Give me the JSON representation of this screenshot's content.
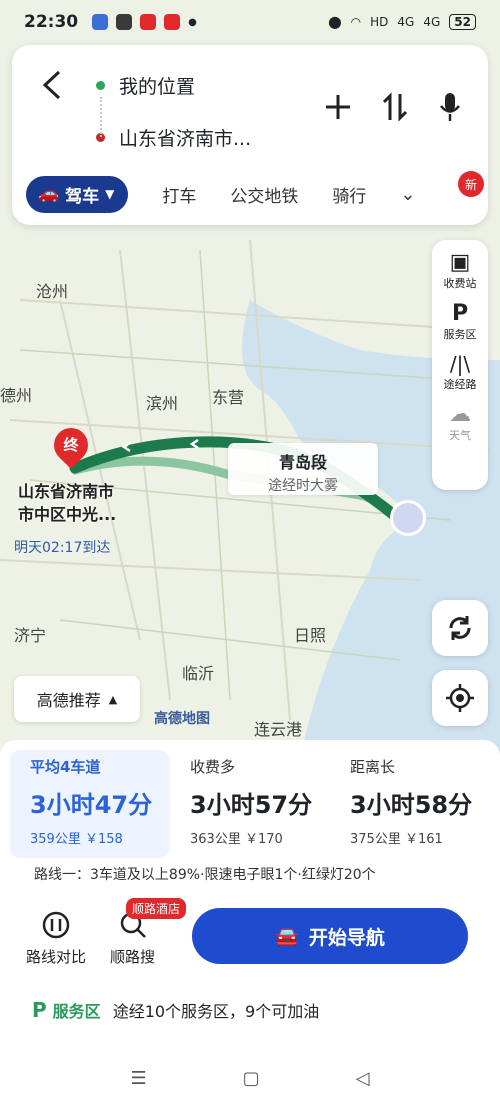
{
  "status": {
    "time": "22:30",
    "battery": "52",
    "signal1": "4G",
    "signal2": "4G",
    "hd": "HD"
  },
  "search": {
    "origin": "我的位置",
    "destination": "山东省济南市..."
  },
  "tabs": [
    {
      "label": "驾车",
      "active": true
    },
    {
      "label": "打车"
    },
    {
      "label": "公交地铁"
    },
    {
      "label": "骑行"
    }
  ],
  "new_badge": "新",
  "tools": {
    "toll": "收费站",
    "service": "服务区",
    "route_pass": "途经路",
    "weather": "天气"
  },
  "map": {
    "cities": [
      "沧州",
      "滨州",
      "东营",
      "德州",
      "济宁",
      "临沂",
      "日照",
      "连云港"
    ],
    "dest_label": "山东省济南市市中区中光...",
    "dest_label_line1": "山东省济南市",
    "dest_label_line2": "市中区中光...",
    "end_pin": "终",
    "arrive": "明天02:17到达",
    "segment_title": "青岛段",
    "segment_sub": "途经时大雾",
    "logo": "高德地图",
    "recommend": "高德推荐"
  },
  "routes": [
    {
      "name": "平均4车道",
      "time": "3小时47分",
      "distance": "359公里",
      "fee": "￥158",
      "selected": true
    },
    {
      "name": "收费多",
      "time": "3小时57分",
      "distance": "363公里",
      "fee": "￥170"
    },
    {
      "name": "距离长",
      "time": "3小时58分",
      "distance": "375公里",
      "fee": "￥161"
    }
  ],
  "route_desc": "路线一：3车道及以上89%·限速电子眼1个·红绿灯20个",
  "buttons": {
    "compare": "路线对比",
    "search_along": "顺路搜",
    "hotel_badge": "顺路酒店",
    "start_nav": "开始导航"
  },
  "service_area": {
    "tag": "服务区",
    "text": "途经10个服务区，9个可加油"
  },
  "colors": {
    "primary": "#1f4ccf",
    "route_green": "#1d7a4a",
    "badge_red": "#e1292c",
    "sea": "#cfe2ef"
  }
}
